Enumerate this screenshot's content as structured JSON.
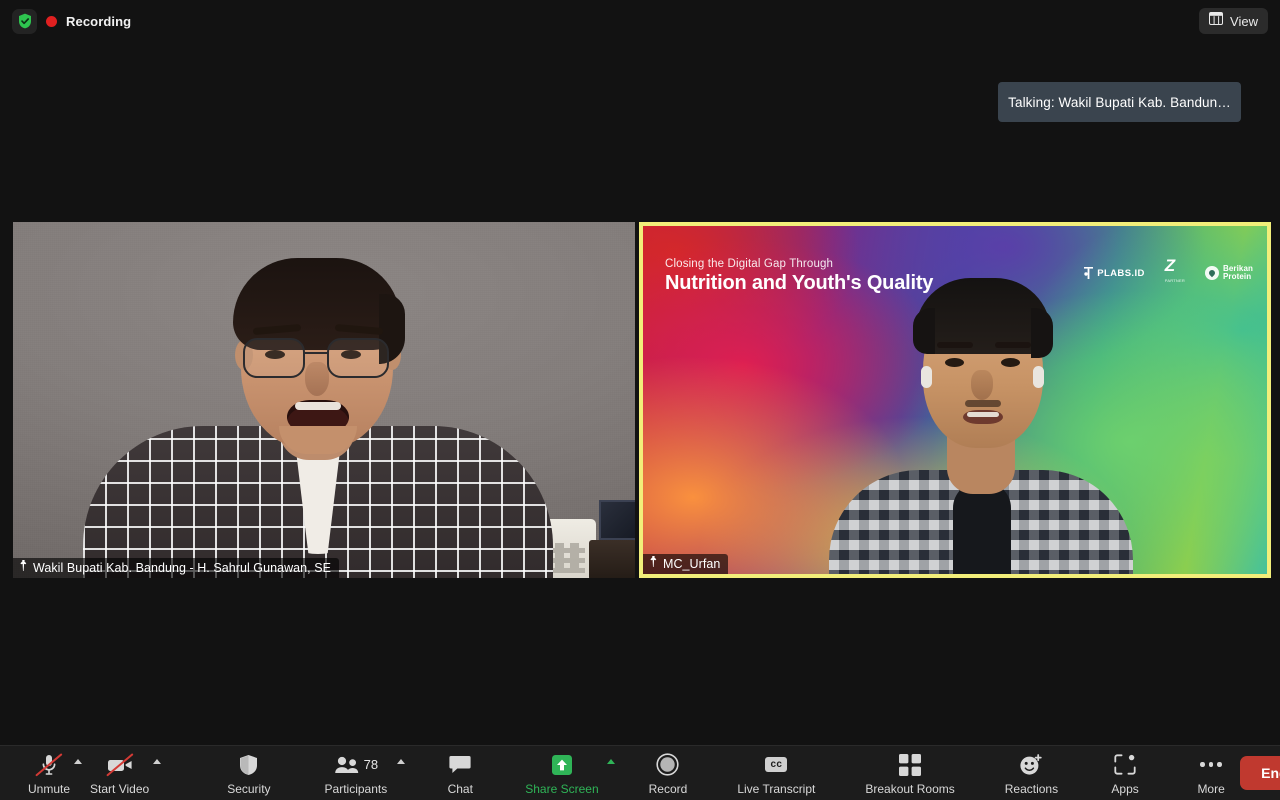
{
  "topbar": {
    "recording_label": "Recording",
    "shield_icon": "shield-check-icon",
    "recording_dot_color": "#e02020",
    "view_button_label": "View",
    "view_icon": "grid-view-icon"
  },
  "talking_indicator": {
    "text": "Talking: Wakil Bupati Kab. Bandun…",
    "background": "#3a444e"
  },
  "video_tiles": [
    {
      "id": "tile-left",
      "participant_name": "Wakil Bupati Kab. Bandung - H. Sahrul Gunawan, SE",
      "pin_icon": "pin-icon",
      "active_speaker": false
    },
    {
      "id": "tile-right",
      "participant_name": "MC_Urfan",
      "pin_icon": "pin-icon",
      "active_speaker": true,
      "active_border_color": "#f2ee7a",
      "virtual_background": {
        "subtitle": "Closing the Digital Gap Through",
        "title": "Nutrition and Youth's Quality",
        "logos": [
          {
            "name": "plabs-id-logo",
            "text": "PLABS.ID"
          },
          {
            "name": "partner-z-logo",
            "text": "Z",
            "subtext": "PARTNER"
          },
          {
            "name": "berikan-protein-logo",
            "line1": "Berikan",
            "line2": "Protein"
          }
        ]
      }
    }
  ],
  "toolbar": {
    "items": [
      {
        "name": "unmute-button",
        "label": "Unmute",
        "icon": "microphone-muted-icon",
        "caret": true,
        "green": false
      },
      {
        "name": "start-video-button",
        "label": "Start Video",
        "icon": "video-muted-icon",
        "caret": true,
        "green": false
      },
      {
        "name": "security-button",
        "label": "Security",
        "icon": "shield-icon",
        "caret": false,
        "green": false
      },
      {
        "name": "participants-button",
        "label": "Participants",
        "icon": "participants-icon",
        "caret": true,
        "green": false,
        "count": "78"
      },
      {
        "name": "chat-button",
        "label": "Chat",
        "icon": "chat-bubble-icon",
        "caret": false,
        "green": false
      },
      {
        "name": "share-screen-button",
        "label": "Share Screen",
        "icon": "share-screen-icon",
        "caret": true,
        "green": true
      },
      {
        "name": "record-button",
        "label": "Record",
        "icon": "record-circle-icon",
        "caret": false,
        "green": false
      },
      {
        "name": "live-transcript-button",
        "label": "Live Transcript",
        "icon": "closed-caption-icon",
        "caret": false,
        "green": false,
        "cc_text": "cc"
      },
      {
        "name": "breakout-rooms-button",
        "label": "Breakout Rooms",
        "icon": "breakout-rooms-icon",
        "caret": false,
        "green": false
      },
      {
        "name": "reactions-button",
        "label": "Reactions",
        "icon": "reactions-smiley-icon",
        "caret": false,
        "green": false
      },
      {
        "name": "apps-button",
        "label": "Apps",
        "icon": "apps-icon",
        "caret": false,
        "green": false
      },
      {
        "name": "more-button",
        "label": "More",
        "icon": "more-dots-icon",
        "caret": false,
        "green": false
      }
    ],
    "end_button_label": "End",
    "end_button_color": "#c0392f",
    "share_screen_accent": "#2fb457"
  }
}
